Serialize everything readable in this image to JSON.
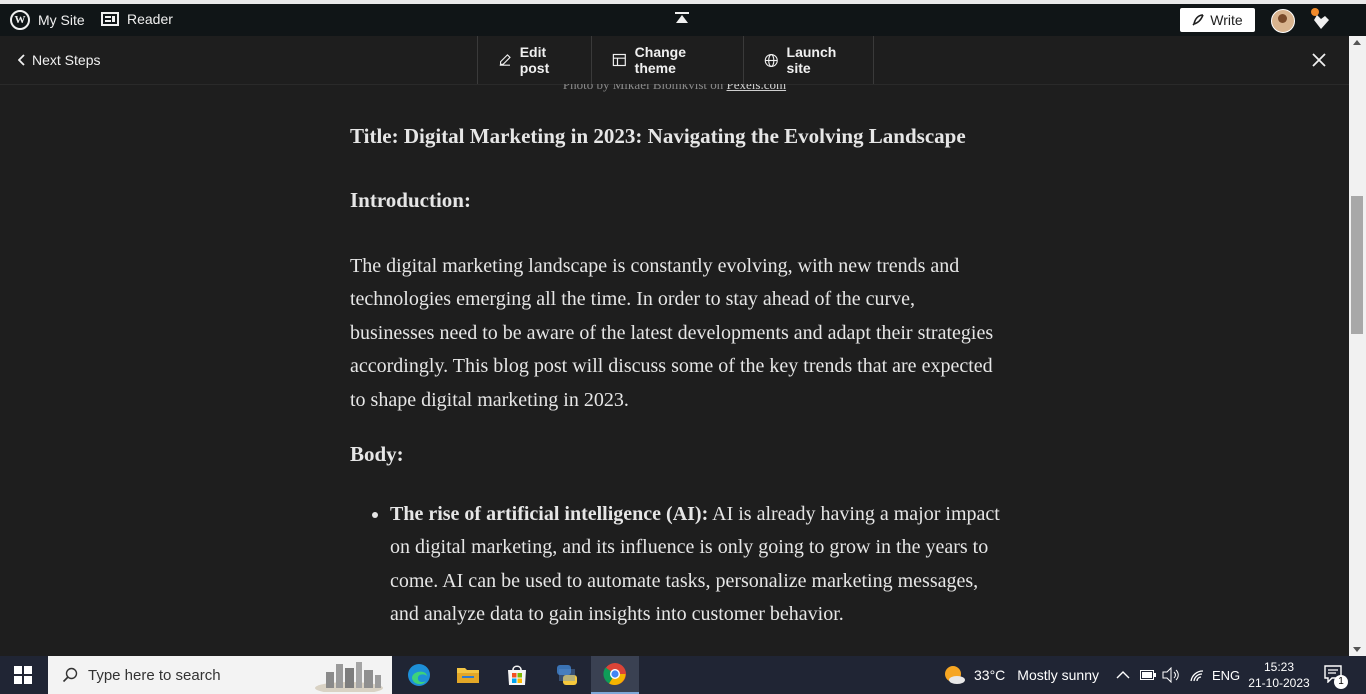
{
  "topbar": {
    "my_site": "My Site",
    "reader": "Reader",
    "write": "Write"
  },
  "navbar": {
    "back": "Next Steps",
    "edit_post": "Edit post",
    "change_theme": "Change theme",
    "launch_site": "Launch site"
  },
  "content": {
    "caption_prefix": "Photo by Mikael Blomkvist on ",
    "caption_link": "Pexels.com",
    "title": "Title: Digital Marketing in 2023: Navigating the Evolving Landscape",
    "intro_heading": "Introduction:",
    "intro_text": "The digital marketing landscape is constantly evolving, with new trends and technologies emerging all the time. In order to stay ahead of the curve, businesses need to be aware of the latest developments and adapt their strategies accordingly. This blog post will discuss some of the key trends that are expected to shape digital marketing in 2023.",
    "body_heading": "Body:",
    "bullets": [
      {
        "bold": "The rise of artificial intelligence (AI):",
        "text": " AI is already having a major impact on digital marketing, and its influence is only going to grow in the years to come. AI can be used to automate tasks, personalize marketing messages, and analyze data to gain insights into customer behavior."
      }
    ]
  },
  "taskbar": {
    "search_placeholder": "Type here to search",
    "weather_temp": "33°C",
    "weather_desc": "Mostly sunny",
    "language": "ENG",
    "time": "15:23",
    "date": "21-10-2023",
    "notification_count": "1"
  },
  "colors": {
    "background": "#1e1e1e",
    "admin_bar": "#101517",
    "taskbar": "#202534",
    "notification_dot": "#f18a2a"
  }
}
